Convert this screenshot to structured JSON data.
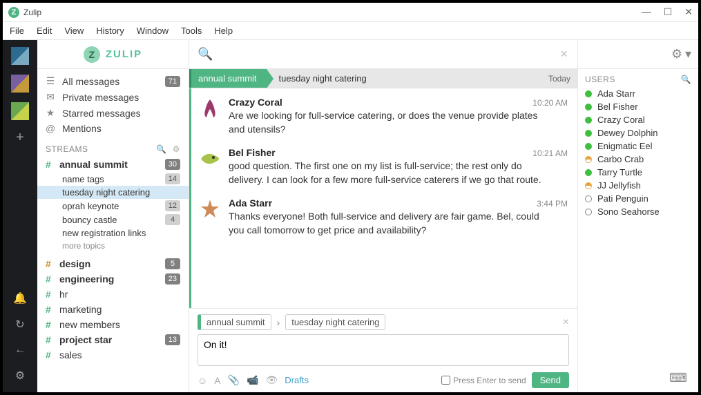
{
  "window": {
    "title": "Zulip"
  },
  "menubar": {
    "file": "File",
    "edit": "Edit",
    "view": "View",
    "history": "History",
    "window": "Window",
    "tools": "Tools",
    "help": "Help"
  },
  "brand": {
    "name": "ZULIP"
  },
  "nav": {
    "all_messages": "All messages",
    "all_messages_badge": "71",
    "private_messages": "Private messages",
    "starred": "Starred messages",
    "mentions": "Mentions"
  },
  "streams_header": "STREAMS",
  "streams": [
    {
      "name": "annual summit",
      "badge": "30",
      "bold": true,
      "color": "green",
      "topics": [
        {
          "name": "name tags",
          "badge": "14"
        },
        {
          "name": "tuesday night catering",
          "active": true
        },
        {
          "name": "oprah keynote",
          "badge": "12"
        },
        {
          "name": "bouncy castle",
          "badge": "4"
        },
        {
          "name": "new registration links"
        }
      ],
      "more_topics": "more topics"
    },
    {
      "name": "design",
      "badge": "5",
      "bold": true,
      "color": "orange"
    },
    {
      "name": "engineering",
      "badge": "23",
      "bold": true,
      "color": "green"
    },
    {
      "name": "hr",
      "color": "green"
    },
    {
      "name": "marketing",
      "color": "green"
    },
    {
      "name": "new members",
      "color": "green"
    },
    {
      "name": "project star",
      "badge": "13",
      "bold": true,
      "color": "green"
    },
    {
      "name": "sales",
      "color": "green"
    }
  ],
  "breadcrumb": {
    "stream": "annual summit",
    "topic": "tuesday night catering",
    "date": "Today"
  },
  "messages": [
    {
      "sender": "Crazy Coral",
      "time": "10:20 AM",
      "text": "Are we looking for full-service catering, or does the venue provide plates and utensils?",
      "avatar": "coral"
    },
    {
      "sender": "Bel Fisher",
      "time": "10:21 AM",
      "text": "good question. The first one on my list is full-service; the rest only do delivery. I can look for a few more full-service caterers if we go that route.",
      "avatar": "fish"
    },
    {
      "sender": "Ada Starr",
      "time": "3:44 PM",
      "text": "Thanks everyone! Both full-service and delivery are fair game. Bel, could you call tomorrow to get price and availability?",
      "avatar": "star"
    }
  ],
  "compose": {
    "stream": "annual summit",
    "topic": "tuesday night catering",
    "draft": "On it!",
    "drafts_label": "Drafts",
    "press_enter": "Press Enter to send",
    "send": "Send"
  },
  "users_header": "USERS",
  "users": [
    {
      "name": "Ada Starr",
      "presence": "online"
    },
    {
      "name": "Bel Fisher",
      "presence": "online"
    },
    {
      "name": "Crazy Coral",
      "presence": "online"
    },
    {
      "name": "Dewey Dolphin",
      "presence": "online"
    },
    {
      "name": "Enigmatic Eel",
      "presence": "online"
    },
    {
      "name": "Carbo Crab",
      "presence": "half"
    },
    {
      "name": "Tarry Turtle",
      "presence": "online"
    },
    {
      "name": "JJ Jellyfish",
      "presence": "half"
    },
    {
      "name": "Pati Penguin",
      "presence": "off"
    },
    {
      "name": "Sono Seahorse",
      "presence": "off"
    }
  ]
}
